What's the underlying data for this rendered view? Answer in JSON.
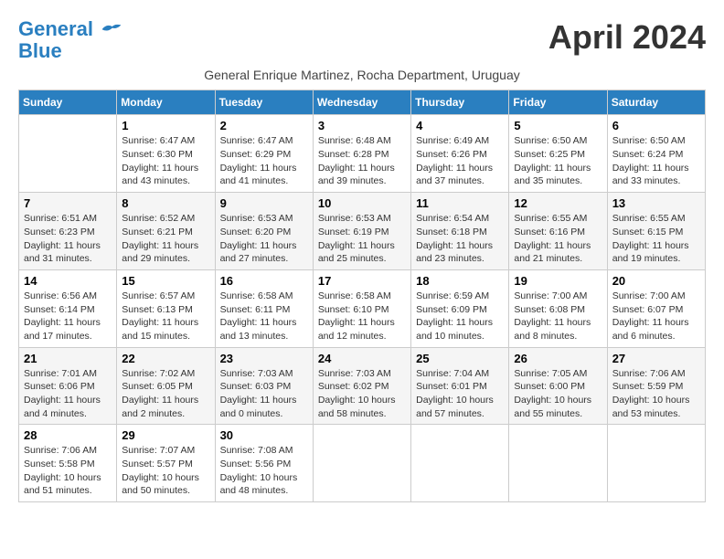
{
  "header": {
    "logo_line1": "General",
    "logo_line2": "Blue",
    "month_title": "April 2024",
    "subtitle": "General Enrique Martinez, Rocha Department, Uruguay"
  },
  "weekdays": [
    "Sunday",
    "Monday",
    "Tuesday",
    "Wednesday",
    "Thursday",
    "Friday",
    "Saturday"
  ],
  "weeks": [
    [
      {
        "day": "",
        "info": ""
      },
      {
        "day": "1",
        "info": "Sunrise: 6:47 AM\nSunset: 6:30 PM\nDaylight: 11 hours\nand 43 minutes."
      },
      {
        "day": "2",
        "info": "Sunrise: 6:47 AM\nSunset: 6:29 PM\nDaylight: 11 hours\nand 41 minutes."
      },
      {
        "day": "3",
        "info": "Sunrise: 6:48 AM\nSunset: 6:28 PM\nDaylight: 11 hours\nand 39 minutes."
      },
      {
        "day": "4",
        "info": "Sunrise: 6:49 AM\nSunset: 6:26 PM\nDaylight: 11 hours\nand 37 minutes."
      },
      {
        "day": "5",
        "info": "Sunrise: 6:50 AM\nSunset: 6:25 PM\nDaylight: 11 hours\nand 35 minutes."
      },
      {
        "day": "6",
        "info": "Sunrise: 6:50 AM\nSunset: 6:24 PM\nDaylight: 11 hours\nand 33 minutes."
      }
    ],
    [
      {
        "day": "7",
        "info": "Sunrise: 6:51 AM\nSunset: 6:23 PM\nDaylight: 11 hours\nand 31 minutes."
      },
      {
        "day": "8",
        "info": "Sunrise: 6:52 AM\nSunset: 6:21 PM\nDaylight: 11 hours\nand 29 minutes."
      },
      {
        "day": "9",
        "info": "Sunrise: 6:53 AM\nSunset: 6:20 PM\nDaylight: 11 hours\nand 27 minutes."
      },
      {
        "day": "10",
        "info": "Sunrise: 6:53 AM\nSunset: 6:19 PM\nDaylight: 11 hours\nand 25 minutes."
      },
      {
        "day": "11",
        "info": "Sunrise: 6:54 AM\nSunset: 6:18 PM\nDaylight: 11 hours\nand 23 minutes."
      },
      {
        "day": "12",
        "info": "Sunrise: 6:55 AM\nSunset: 6:16 PM\nDaylight: 11 hours\nand 21 minutes."
      },
      {
        "day": "13",
        "info": "Sunrise: 6:55 AM\nSunset: 6:15 PM\nDaylight: 11 hours\nand 19 minutes."
      }
    ],
    [
      {
        "day": "14",
        "info": "Sunrise: 6:56 AM\nSunset: 6:14 PM\nDaylight: 11 hours\nand 17 minutes."
      },
      {
        "day": "15",
        "info": "Sunrise: 6:57 AM\nSunset: 6:13 PM\nDaylight: 11 hours\nand 15 minutes."
      },
      {
        "day": "16",
        "info": "Sunrise: 6:58 AM\nSunset: 6:11 PM\nDaylight: 11 hours\nand 13 minutes."
      },
      {
        "day": "17",
        "info": "Sunrise: 6:58 AM\nSunset: 6:10 PM\nDaylight: 11 hours\nand 12 minutes."
      },
      {
        "day": "18",
        "info": "Sunrise: 6:59 AM\nSunset: 6:09 PM\nDaylight: 11 hours\nand 10 minutes."
      },
      {
        "day": "19",
        "info": "Sunrise: 7:00 AM\nSunset: 6:08 PM\nDaylight: 11 hours\nand 8 minutes."
      },
      {
        "day": "20",
        "info": "Sunrise: 7:00 AM\nSunset: 6:07 PM\nDaylight: 11 hours\nand 6 minutes."
      }
    ],
    [
      {
        "day": "21",
        "info": "Sunrise: 7:01 AM\nSunset: 6:06 PM\nDaylight: 11 hours\nand 4 minutes."
      },
      {
        "day": "22",
        "info": "Sunrise: 7:02 AM\nSunset: 6:05 PM\nDaylight: 11 hours\nand 2 minutes."
      },
      {
        "day": "23",
        "info": "Sunrise: 7:03 AM\nSunset: 6:03 PM\nDaylight: 11 hours\nand 0 minutes."
      },
      {
        "day": "24",
        "info": "Sunrise: 7:03 AM\nSunset: 6:02 PM\nDaylight: 10 hours\nand 58 minutes."
      },
      {
        "day": "25",
        "info": "Sunrise: 7:04 AM\nSunset: 6:01 PM\nDaylight: 10 hours\nand 57 minutes."
      },
      {
        "day": "26",
        "info": "Sunrise: 7:05 AM\nSunset: 6:00 PM\nDaylight: 10 hours\nand 55 minutes."
      },
      {
        "day": "27",
        "info": "Sunrise: 7:06 AM\nSunset: 5:59 PM\nDaylight: 10 hours\nand 53 minutes."
      }
    ],
    [
      {
        "day": "28",
        "info": "Sunrise: 7:06 AM\nSunset: 5:58 PM\nDaylight: 10 hours\nand 51 minutes."
      },
      {
        "day": "29",
        "info": "Sunrise: 7:07 AM\nSunset: 5:57 PM\nDaylight: 10 hours\nand 50 minutes."
      },
      {
        "day": "30",
        "info": "Sunrise: 7:08 AM\nSunset: 5:56 PM\nDaylight: 10 hours\nand 48 minutes."
      },
      {
        "day": "",
        "info": ""
      },
      {
        "day": "",
        "info": ""
      },
      {
        "day": "",
        "info": ""
      },
      {
        "day": "",
        "info": ""
      }
    ]
  ]
}
